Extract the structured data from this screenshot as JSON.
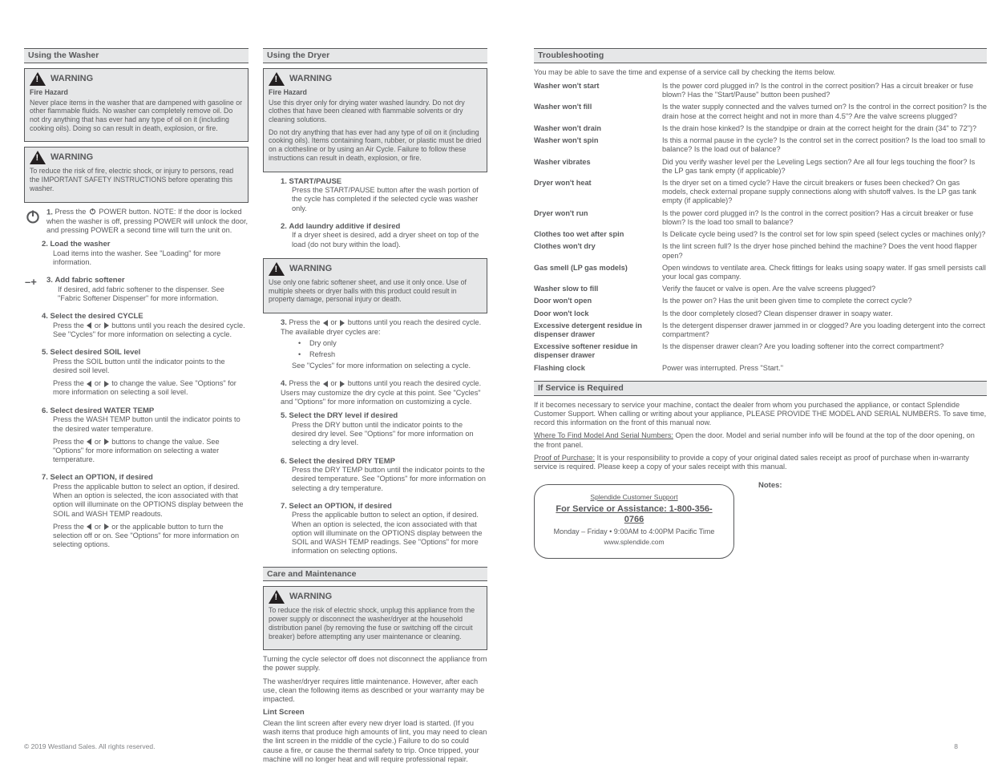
{
  "col1": {
    "bar": "Using the Washer",
    "warn1_head": "WARNING",
    "warn1_text": "Fire Hazard",
    "warn1_body": "Never place items in the washer that are dampened with gasoline or other flammable fluids. No washer can completely remove oil. Do not dry anything that has ever had any type of oil on it (including cooking oils). Doing so can result in death, explosion, or fire.",
    "warn2_head": "WARNING",
    "warn2_body": "To reduce the risk of fire, electric shock, or injury to persons, read the IMPORTANT SAFETY INSTRUCTIONS before operating this washer.",
    "step1_icon_label": "Power",
    "step1_body": "Press the       POWER button. NOTE: If the door is locked when the washer is off, pressing POWER will unlock the door, and pressing POWER a second time will turn the unit on.",
    "step2_head": "Load the washer",
    "step2_body": "Load items into the washer. See \"Loading\" for more information.",
    "step3_head": "Add fabric softener",
    "step3_body": "If desired, add fabric softener to the dispenser. See \"Fabric Softener Dispenser\" for more information.",
    "step4_head": "Select the desired CYCLE",
    "step4_body": "Press the     or     buttons until you reach the desired cycle. See \"Cycles\" for more information on selecting a cycle.",
    "step5_head": "Select desired SOIL level",
    "step5_body1": "Press the SOIL button until the indicator points to the desired soil level.",
    "step5_body2": "Press the     or     to change the value. See \"Options\" for more information on selecting a soil level.",
    "step6_head": "Select desired WATER TEMP",
    "step6_body1": "Press the WASH TEMP button until the indicator points to the desired water temperature.",
    "step6_body2": "Press the     or     buttons to change the value. See \"Options\" for more information on selecting a water temperature.",
    "step7_head": "Select an OPTION, if desired",
    "step7_body1": "Press the applicable button to select an option, if desired. When an option is selected, the icon associated with that option will illuminate on the OPTIONS display between the SOIL and WASH TEMP readouts.",
    "step7_body2": "Press the     or     or the applicable button to turn the selection off or on. See \"Options\" for more information on selecting options."
  },
  "col2": {
    "bar": "Using the Dryer",
    "warn1_head": "WARNING",
    "warn1_text": "Fire Hazard",
    "warn1_body1": "Use this dryer only for drying water washed laundry. Do not dry clothes that have been cleaned with flammable solvents or dry cleaning solutions.",
    "warn1_body2": "Do not dry anything that has ever had any type of oil on it (including cooking oils). Items containing foam, rubber, or plastic must be dried on a clothesline or by using an Air Cycle. Failure to follow these instructions can result in death, explosion, or fire.",
    "step1_head": "START/PAUSE",
    "step1_body": "Press the START/PAUSE button after the wash portion of the cycle has completed if the selected cycle was washer only.",
    "step2_head": "Add laundry additive if desired",
    "step2_body": "If a dryer sheet is desired, add a dryer sheet on top of the load (do not bury within the load).",
    "warn2_head": "WARNING",
    "warn2_body": "Use only one fabric softener sheet, and use it only once. Use of multiple sheets or dryer balls with this product could result in property damage, personal injury or death.",
    "step3_body_a": "Press the     or     buttons until you reach the desired cycle. The available dryer cycles are:",
    "step3_list1": "Dry only",
    "step3_list2": "Refresh",
    "step3_body_b": "See \"Cycles\" for more information on selecting a cycle.",
    "step4_body_a": "Press the     or     buttons until you reach the desired cycle. Users may customize the dry cycle at this point. See \"Cycles\" and \"Options\" for more information on customizing a cycle.",
    "step5_head": "Select the DRY level if desired",
    "step5_body": "Press the DRY button until the indicator points to the desired dry level. See \"Options\" for more information on selecting a dry level.",
    "step6_head": "Select the desired DRY TEMP",
    "step6_body": "Press the DRY TEMP button until the indicator points to the desired temperature. See \"Options\" for more information on selecting a dry temperature.",
    "step7_head": "Select an OPTION, if desired",
    "step7_body": "Press the applicable button to select an option, if desired. When an option is selected, the icon associated with that option will illuminate on the OPTIONS display between the SOIL and WASH TEMP readings. See \"Options\" for more information on selecting options.",
    "maint_bar": "Care and Maintenance",
    "warn3_head": "WARNING",
    "warn3_body": "To reduce the risk of electric shock, unplug this appliance from the power supply or disconnect the washer/dryer at the household distribution panel (by removing the fuse or switching off the circuit breaker) before attempting any user maintenance or cleaning.",
    "maint_p1": "Turning the cycle selector off does not disconnect the appliance from the power supply.",
    "maint_p2": "The washer/dryer requires little maintenance. However, after each use, clean the following items as described or your warranty may be impacted.",
    "lint_head": "Lint Screen",
    "lint_body": "Clean the lint screen after every new dryer load is started. (If you wash items that produce high amounts of lint, you may need to clean the lint screen in the middle of the cycle.) Failure to do so could cause a fire, or cause the thermal safety to trip. Once tripped, your machine will no longer heat and will require professional repair."
  },
  "col3": {
    "bar": "Troubleshooting",
    "intro": "You may be able to save the time and expense of a service call by checking the items below.",
    "rows": [
      [
        "Washer won't start",
        "Is the power cord plugged in? Is the control in the correct position? Has a circuit breaker or fuse blown? Has the \"Start/Pause\" button been pushed?"
      ],
      [
        "Washer won't fill",
        "Is the water supply connected and the valves turned on? Is the control in the correct position? Is the drain hose at the correct height and not in more than 4.5\"? Are the valve screens plugged?"
      ],
      [
        "Washer won't drain",
        "Is the drain hose kinked? Is the standpipe or drain at the correct height for the drain (34\" to 72\")?"
      ],
      [
        "Washer won't spin",
        "Is this a normal pause in the cycle? Is the control set in the correct position? Is the load too small to balance? Is the load out of balance?"
      ],
      [
        "Washer vibrates",
        "Did you verify washer level per the Leveling Legs section? Are all four legs touching the floor? Is the LP gas tank empty (if applicable)?"
      ],
      [
        "Dryer won't heat",
        "Is the dryer set on a timed cycle? Have the circuit breakers or fuses been checked? On gas models, check external propane supply connections along with shutoff valves. Is the LP gas tank empty (if applicable)?"
      ],
      [
        "Dryer won't run",
        "Is the power cord plugged in? Is the control in the correct position? Has a circuit breaker or fuse blown? Is the load too small to balance?"
      ],
      [
        "Clothes too wet after spin",
        "Is Delicate cycle being used? Is the control set for low spin speed (select cycles or machines only)?"
      ],
      [
        "Clothes won't dry",
        "Is the lint screen full? Is the dryer hose pinched behind the machine? Does the vent hood flapper open?"
      ],
      [
        "Gas smell (LP gas models)",
        "Open windows to ventilate area. Check fittings for leaks using soapy water. If gas smell persists call your local gas company."
      ],
      [
        "Washer slow to fill",
        "Verify the faucet or valve is open. Are the valve screens plugged?"
      ],
      [
        "Door won't open",
        "Is the power on? Has the unit been given time to complete the correct cycle?"
      ],
      [
        "Door won't lock",
        "Is the door completely closed? Clean dispenser drawer in soapy water."
      ],
      [
        "Excessive detergent residue in dispenser drawer",
        "Is the detergent dispenser drawer jammed in or clogged? Are you loading detergent into the correct compartment?"
      ],
      [
        "Excessive softener residue in dispenser drawer",
        "Is the dispenser drawer clean? Are you loading softener into the correct compartment?"
      ],
      [
        "Flashing clock",
        "Power was interrupted. Press \"Start.\""
      ]
    ],
    "dealer_bar": "If Service is Required",
    "dealer_p1": "If it becomes necessary to service your machine, contact the dealer from whom you purchased the appliance, or contact Splendide Customer Support. When calling or writing about your appliance, PLEASE PROVIDE THE MODEL AND SERIAL NUMBERS. To save time, record this information on the front of this manual now.",
    "dealer_p2_a": "Where To Find Model And Serial Numbers:",
    "dealer_p2_b": "Open the door. Model and serial number info will be found at the top of the door opening, on the front panel.",
    "dealer_p3_a": "Proof of Purchase:",
    "dealer_p3_b": "It is your responsibility to provide a copy of your original dated sales receipt as proof of purchase when in-warranty service is required. Please keep a copy of your sales receipt with this manual.",
    "service_title_a": "Splendide Customer Support",
    "service_title_b": "For Service or Assistance: 1-800-356-0766",
    "service_hours": "Monday – Friday • 9:00AM to 4:00PM Pacific Time",
    "service_site": "www.splendide.com",
    "notes_head": "Notes:"
  },
  "footer_left": "© 2019 Westland Sales. All rights reserved.",
  "footer_right": "8"
}
